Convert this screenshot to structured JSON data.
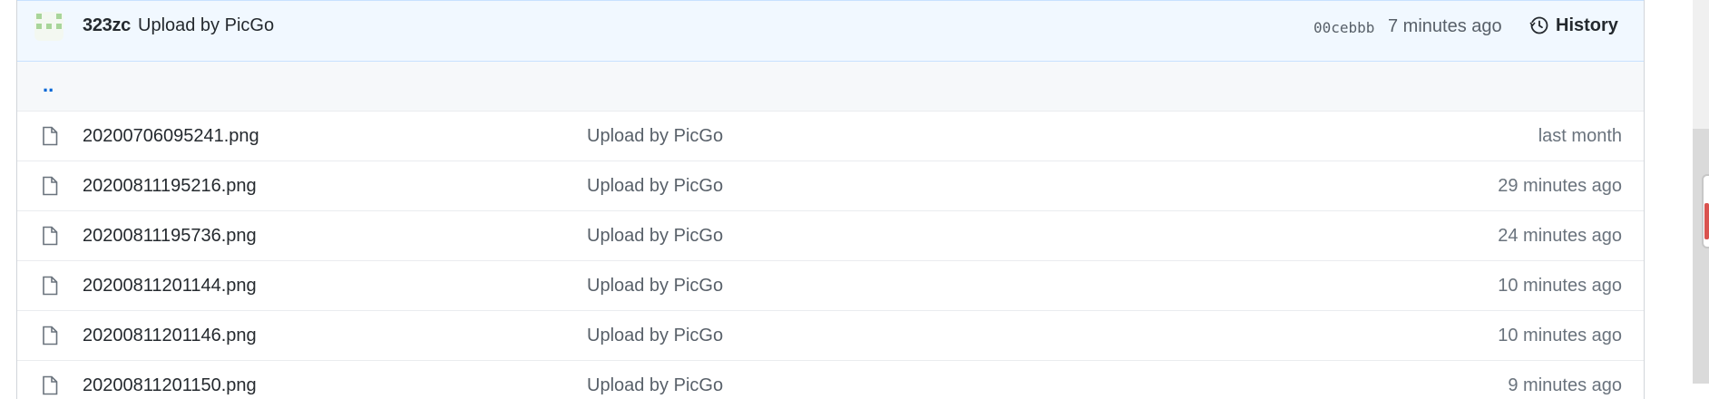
{
  "commit": {
    "author": "323zc",
    "message": "Upload by PicGo",
    "sha": "00cebbb",
    "time_ago": "7 minutes ago",
    "history_label": "History"
  },
  "parent_dir": "..",
  "files": [
    {
      "name": "20200706095241.png",
      "message": "Upload by PicGo",
      "age": "last month"
    },
    {
      "name": "20200811195216.png",
      "message": "Upload by PicGo",
      "age": "29 minutes ago"
    },
    {
      "name": "20200811195736.png",
      "message": "Upload by PicGo",
      "age": "24 minutes ago"
    },
    {
      "name": "20200811201144.png",
      "message": "Upload by PicGo",
      "age": "10 minutes ago"
    },
    {
      "name": "20200811201146.png",
      "message": "Upload by PicGo",
      "age": "10 minutes ago"
    },
    {
      "name": "20200811201150.png",
      "message": "Upload by PicGo",
      "age": "9 minutes ago"
    }
  ],
  "icons": {
    "file": "file-icon",
    "history": "history-icon",
    "avatar": "identicon-avatar"
  },
  "colors": {
    "link": "#0366d6",
    "commit_bar_bg": "#f1f8ff",
    "avatar_green": "#a8d59a"
  }
}
